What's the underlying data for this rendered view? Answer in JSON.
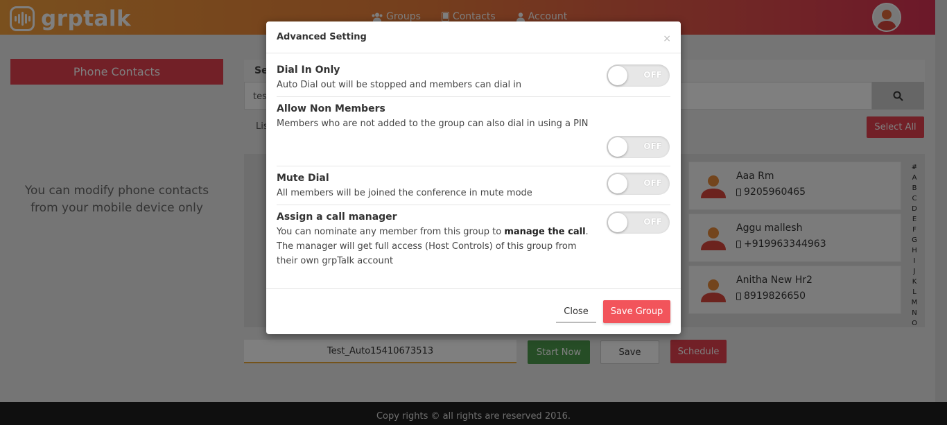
{
  "header": {
    "brand": "grptalk",
    "nav": [
      {
        "label": "Groups",
        "icon": "groups-icon"
      },
      {
        "label": "Contacts",
        "icon": "contacts-icon"
      },
      {
        "label": "Account",
        "icon": "account-icon"
      }
    ]
  },
  "sidebar": {
    "phone_contacts_label": "Phone Contacts",
    "message": "You can modify phone contacts from your mobile device only"
  },
  "main": {
    "search_heading": "Se",
    "search_value": "tes",
    "list_label": "Lis",
    "select_all_label": "Select All",
    "contacts": [
      {
        "name": "Aaa Rm",
        "phone": "9205960465"
      },
      {
        "name": "Aggu mallesh",
        "phone": "+919963344963"
      },
      {
        "name": "Anitha New Hr2",
        "phone": "8919826650"
      }
    ],
    "alphabet": [
      "#",
      "A",
      "B",
      "C",
      "D",
      "E",
      "F",
      "G",
      "H",
      "I",
      "J",
      "K",
      "L",
      "M",
      "N",
      "O"
    ],
    "group_name": "Test_Auto15410673513",
    "start_now_label": "Start Now",
    "save_label": "Save",
    "schedule_label": "Schedule"
  },
  "footer": {
    "text": "Copy rights © all rights are reserved 2016."
  },
  "modal": {
    "title": "Advanced Setting",
    "close_glyph": "×",
    "settings": [
      {
        "title": "Dial In Only",
        "description": "Auto Dial out will be stopped and members can dial in",
        "state": "OFF"
      },
      {
        "title": "Allow Non Members",
        "description": "Members who are not added to the group can also dial in using a PIN",
        "state": "OFF"
      },
      {
        "title": "Mute Dial",
        "description": "All members will be joined the conference in mute mode",
        "state": "OFF"
      },
      {
        "title": "Assign a call manager",
        "desc_before": "You can nominate any member from this group to ",
        "desc_bold": "manage the call",
        "desc_after": ". The manager will get full access (Host Controls) of this group from their own grpTalk account",
        "state": "OFF"
      }
    ],
    "close_label": "Close",
    "save_group_label": "Save Group"
  },
  "colors": {
    "accent_red": "#e5404f",
    "start_green": "#4c9a4c",
    "header_start": "#f4a03c",
    "header_end": "#d82f53"
  }
}
